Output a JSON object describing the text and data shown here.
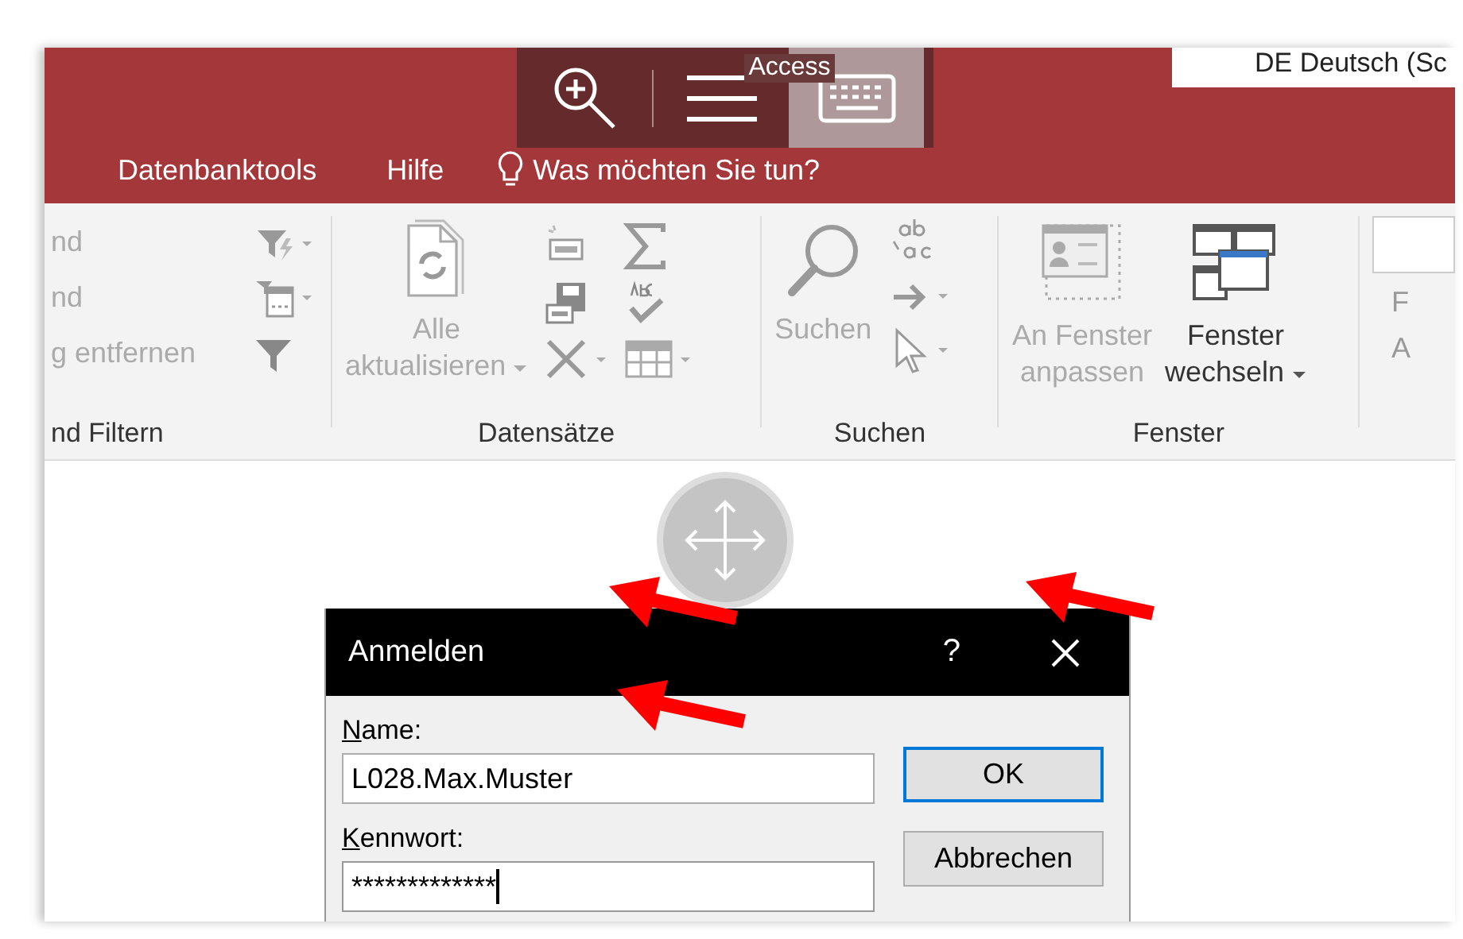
{
  "window": {
    "title": "Access"
  },
  "overlay_toolbar": [
    {
      "kind": "zoom",
      "selected": false
    },
    {
      "kind": "menu",
      "selected": false
    },
    {
      "kind": "keyboard",
      "selected": true
    }
  ],
  "language": "DE Deutsch (Sc",
  "tabs": [
    {
      "label": "Datenbanktools",
      "selected": false
    },
    {
      "label": "Hilfe",
      "selected": false
    }
  ],
  "tell_me": "Was möchten Sie tun?",
  "ribbon": {
    "sort_filter": {
      "label": "nd Filtern",
      "commands": [
        {
          "text": "nd",
          "disabled": true
        },
        {
          "text": "nd",
          "disabled": true
        },
        {
          "text": "g entfernen",
          "disabled": true
        }
      ]
    },
    "records": {
      "label": "Datensätze",
      "refresh": {
        "lines": [
          "Alle",
          "aktualisieren"
        ],
        "disabled": true
      }
    },
    "find": {
      "label": "Suchen",
      "search": {
        "text": "Suchen",
        "disabled": true
      }
    },
    "window": {
      "label": "Fenster",
      "commands": [
        {
          "lines": [
            "An Fenster",
            "anpassen"
          ],
          "disabled": true,
          "caret": false
        },
        {
          "lines": [
            "Fenster",
            "wechseln"
          ],
          "disabled": false,
          "caret": true
        }
      ]
    },
    "column_5": {
      "letters": [
        "F",
        "A"
      ]
    }
  },
  "dialog": {
    "title": "Anmelden",
    "help": "?",
    "fields": [
      {
        "label": "Name:",
        "value": "L028.Max.Muster",
        "focused": false
      },
      {
        "label": "Kennwort:",
        "value": "*************",
        "focused": true
      }
    ],
    "buttons": [
      {
        "label": "OK",
        "default": true
      },
      {
        "label": "Abbrechen",
        "default": false
      }
    ]
  }
}
